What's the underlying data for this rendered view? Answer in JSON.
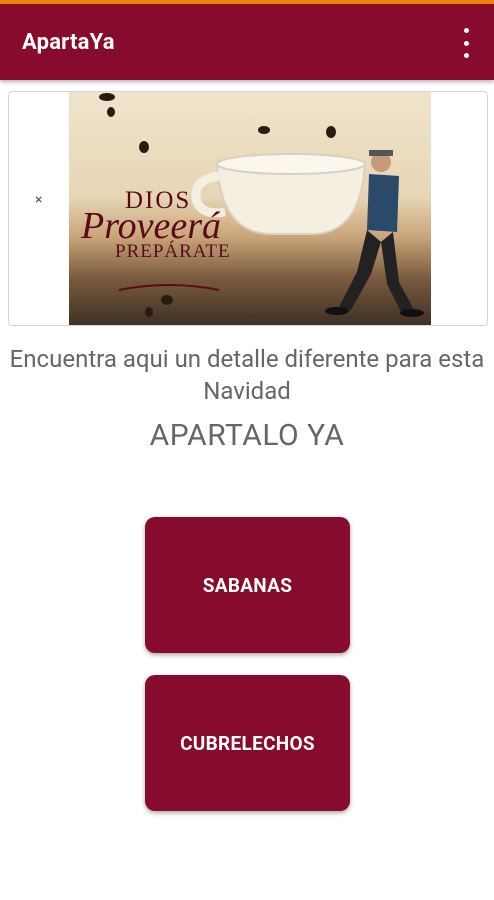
{
  "app": {
    "title": "ApartaYa"
  },
  "ad": {
    "close_symbol": "×",
    "line1": "DIOS",
    "line2": "Proveerá",
    "line3": "PREPÁRATE"
  },
  "main": {
    "tagline": "Encuentra aqui un detalle diferente para esta Navidad",
    "headline": "APARTALO YA",
    "buttons": [
      "SABANAS",
      "CUBRELECHOS"
    ]
  },
  "colors": {
    "primary": "#870b2c",
    "statusbar_accent": "#f0820f",
    "text_gray": "#666666"
  }
}
